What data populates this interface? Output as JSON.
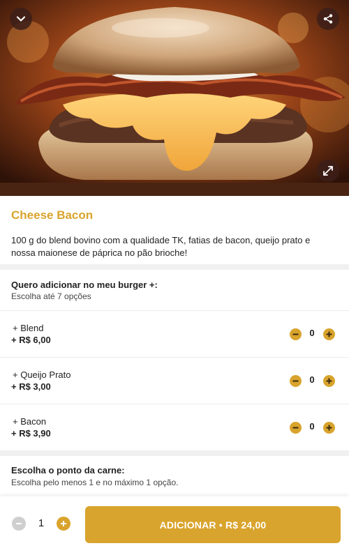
{
  "colors": {
    "accent": "#d9a42d",
    "divider": "#f0f0f0"
  },
  "hero": {
    "icons": {
      "back": "chevron-down-icon",
      "share": "share-icon",
      "expand": "expand-icon"
    }
  },
  "product": {
    "title": "Cheese Bacon",
    "description": "100 g do blend bovino com a qualidade TK, fatias de bacon, queijo prato e nossa maionese de páprica no pão brioche!"
  },
  "addons": {
    "title": "Quero adicionar no meu burger +:",
    "subtitle": "Escolha até 7 opções",
    "items": [
      {
        "name": "+ Blend",
        "price": "+ R$ 6,00",
        "qty": "0"
      },
      {
        "name": "+ Queijo Prato",
        "price": "+ R$ 3,00",
        "qty": "0"
      },
      {
        "name": "+ Bacon",
        "price": "+ R$ 3,90",
        "qty": "0"
      }
    ]
  },
  "doneness": {
    "title": "Escolha o ponto da carne:",
    "subtitle": "Escolha pelo menos 1 e no máximo 1 opção."
  },
  "cart": {
    "quantity": "1",
    "add_label": "ADICIONAR • R$ 24,00"
  }
}
